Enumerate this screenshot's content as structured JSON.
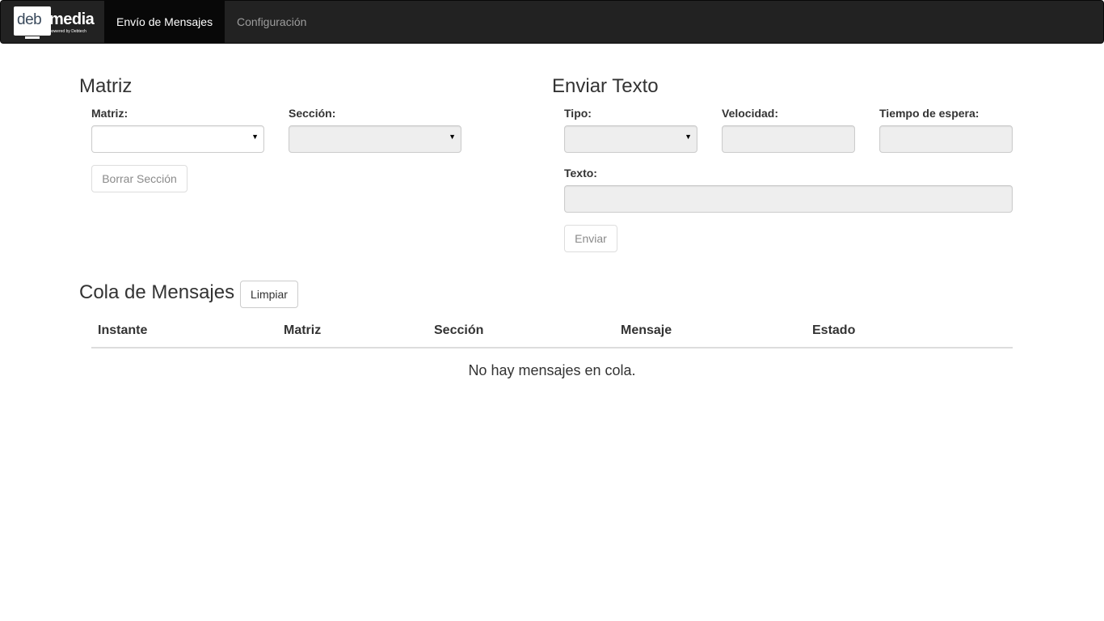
{
  "navbar": {
    "brand": {
      "deb": "deb",
      "media": "media",
      "powered": "powered by Debtech"
    },
    "items": [
      {
        "label": "Envío de Mensajes",
        "active": true
      },
      {
        "label": "Configuración",
        "active": false
      }
    ]
  },
  "matriz_section": {
    "title": "Matriz",
    "matriz_label": "Matriz:",
    "matriz_value": "",
    "seccion_label": "Sección:",
    "seccion_value": "",
    "borrar_button": "Borrar Sección"
  },
  "enviar_section": {
    "title": "Enviar Texto",
    "tipo_label": "Tipo:",
    "tipo_value": "",
    "velocidad_label": "Velocidad:",
    "velocidad_value": "",
    "tiempo_label": "Tiempo de espera:",
    "tiempo_value": "",
    "texto_label": "Texto:",
    "texto_value": "",
    "enviar_button": "Enviar"
  },
  "cola_section": {
    "title": "Cola de Mensajes",
    "limpiar_button": "Limpiar",
    "columns": [
      "Instante",
      "Matriz",
      "Sección",
      "Mensaje",
      "Estado"
    ],
    "rows": [],
    "empty_message": "No hay mensajes en cola."
  },
  "colors": {
    "navbar_bg": "#222222",
    "navbar_active_bg": "#080808",
    "navbar_inactive_text": "#9d9d9d",
    "disabled_field_bg": "#eeeeee"
  }
}
